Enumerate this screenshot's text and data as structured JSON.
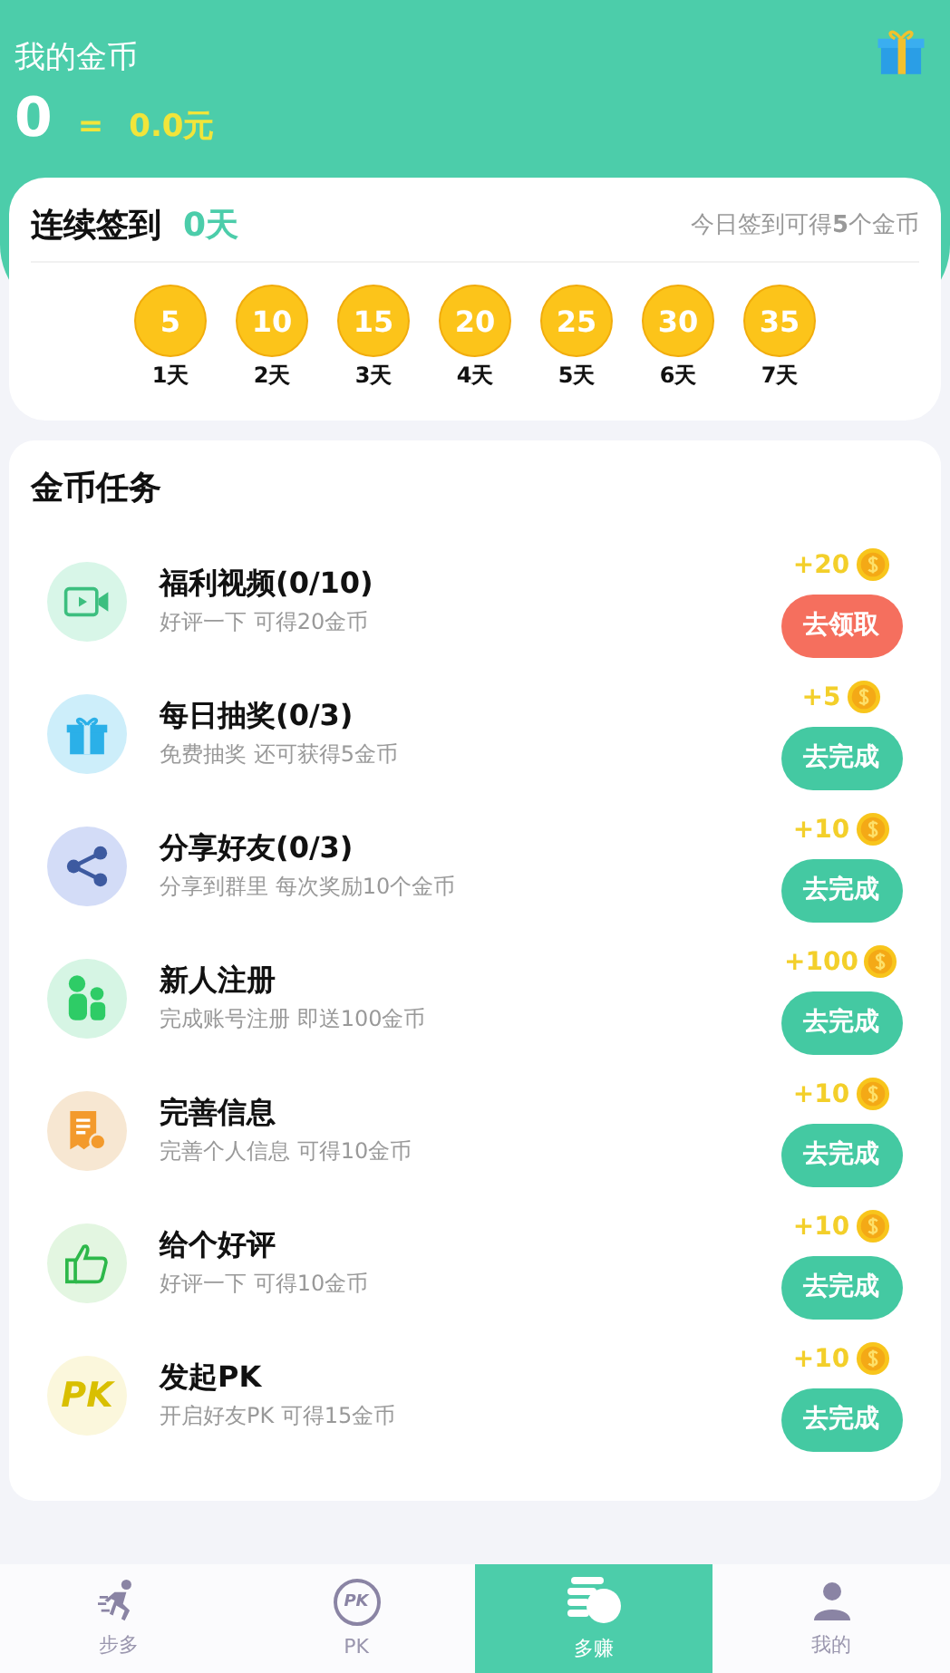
{
  "header": {
    "title": "我的金币",
    "coins": "0",
    "equals": "=",
    "money": "0.0元"
  },
  "checkin": {
    "title": "连续签到",
    "days": "0天",
    "hint": "今日签到可得**5**个金币",
    "rewards": [
      {
        "amount": "5",
        "day": "1天"
      },
      {
        "amount": "10",
        "day": "2天"
      },
      {
        "amount": "15",
        "day": "3天"
      },
      {
        "amount": "20",
        "day": "4天"
      },
      {
        "amount": "25",
        "day": "5天"
      },
      {
        "amount": "30",
        "day": "6天"
      },
      {
        "amount": "35",
        "day": "7天"
      }
    ]
  },
  "tasks_title": "金币任务",
  "tasks": [
    {
      "kind": "video",
      "title": "福利视频(0/10)",
      "desc": "好评一下 可得20金币",
      "reward": "+20",
      "button": "去领取",
      "claimable": true
    },
    {
      "kind": "gift",
      "title": "每日抽奖(0/3)",
      "desc": "免费抽奖 还可获得5金币",
      "reward": "+5",
      "button": "去完成",
      "claimable": false
    },
    {
      "kind": "share",
      "title": "分享好友(0/3)",
      "desc": "分享到群里 每次奖励10个金币",
      "reward": "+10",
      "button": "去完成",
      "claimable": false
    },
    {
      "kind": "users",
      "title": "新人注册",
      "desc": "完成账号注册 即送100金币",
      "reward": "+100",
      "button": "去完成",
      "claimable": false
    },
    {
      "kind": "doc",
      "title": "完善信息",
      "desc": "完善个人信息 可得10金币",
      "reward": "+10",
      "button": "去完成",
      "claimable": false
    },
    {
      "kind": "thumb",
      "title": "给个好评",
      "desc": "好评一下 可得10金币",
      "reward": "+10",
      "button": "去完成",
      "claimable": false
    },
    {
      "kind": "pk",
      "icon_text": "PK",
      "title": "发起PK",
      "desc": "开启好友PK 可得15金币",
      "reward": "+10",
      "button": "去完成",
      "claimable": false
    }
  ],
  "tabs": [
    {
      "kind": "run",
      "label": "步多",
      "selected": false
    },
    {
      "kind": "pk",
      "icon_text": "PK",
      "label": "PK",
      "selected": false
    },
    {
      "kind": "coins",
      "label": "多赚",
      "selected": true
    },
    {
      "kind": "person",
      "label": "我的",
      "selected": false
    }
  ]
}
